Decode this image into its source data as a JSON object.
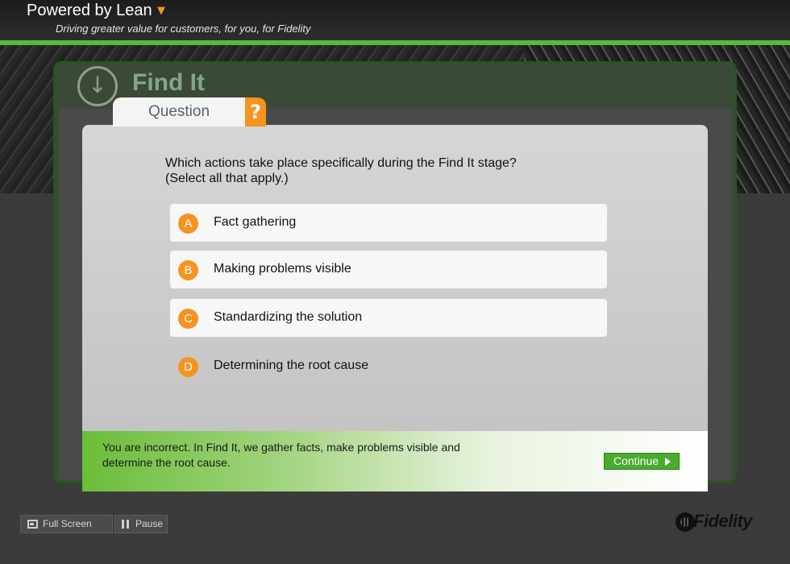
{
  "header": {
    "title": "Powered by Lean",
    "tagline": "Driving greater value for customers, for you, for Fidelity"
  },
  "slide": {
    "section_title": "Find It"
  },
  "question": {
    "tab_label": "Question",
    "help_glyph": "?",
    "prompt_line1": "Which actions take place specifically during the Find It stage?",
    "prompt_line2": "(Select all that apply.)",
    "choices": [
      {
        "letter": "A",
        "text": "Fact gathering"
      },
      {
        "letter": "B",
        "text": "Making problems visible"
      },
      {
        "letter": "C",
        "text": "Standardizing the solution"
      },
      {
        "letter": "D",
        "text": "Determining the root cause"
      }
    ]
  },
  "feedback": {
    "message": "You are incorrect. In Find It, we gather facts, make problems visible and determine the root cause.",
    "continue_label": "Continue"
  },
  "controls": {
    "full_screen_label": "Full Screen",
    "pause_label": "Pause"
  },
  "branding": {
    "logo_text": "Fidelity"
  },
  "colors": {
    "accent_orange": "#f7931e",
    "accent_green": "#5bb83c"
  }
}
